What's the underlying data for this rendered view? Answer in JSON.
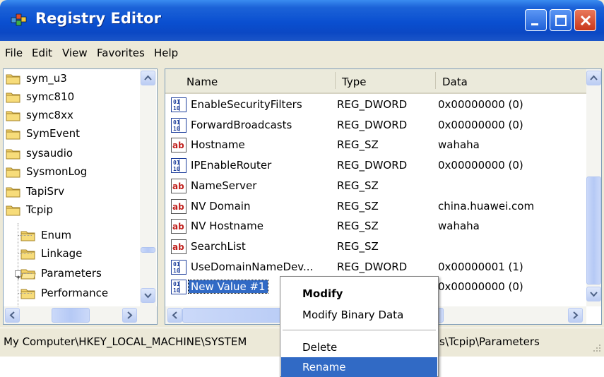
{
  "window": {
    "title": "Registry Editor"
  },
  "menu": [
    "File",
    "Edit",
    "View",
    "Favorites",
    "Help"
  ],
  "tree": {
    "items": [
      {
        "label": "sym_u3"
      },
      {
        "label": "symc810"
      },
      {
        "label": "symc8xx"
      },
      {
        "label": "SymEvent"
      },
      {
        "label": "sysaudio"
      },
      {
        "label": "SysmonLog"
      },
      {
        "label": "TapiSrv"
      },
      {
        "label": "Tcpip"
      },
      {
        "label": "Enum"
      },
      {
        "label": "Linkage"
      },
      {
        "label": "Parameters"
      },
      {
        "label": "Performance"
      }
    ]
  },
  "list": {
    "columns": [
      "Name",
      "Type",
      "Data"
    ],
    "rows": [
      {
        "icon": "binary-value-icon",
        "name": "EnableSecurityFilters",
        "type": "REG_DWORD",
        "data": "0x00000000 (0)"
      },
      {
        "icon": "binary-value-icon",
        "name": "ForwardBroadcasts",
        "type": "REG_DWORD",
        "data": "0x00000000 (0)"
      },
      {
        "icon": "string-value-icon",
        "name": "Hostname",
        "type": "REG_SZ",
        "data": "wahaha"
      },
      {
        "icon": "binary-value-icon",
        "name": "IPEnableRouter",
        "type": "REG_DWORD",
        "data": "0x00000000 (0)"
      },
      {
        "icon": "string-value-icon",
        "name": "NameServer",
        "type": "REG_SZ",
        "data": ""
      },
      {
        "icon": "string-value-icon",
        "name": "NV Domain",
        "type": "REG_SZ",
        "data": "china.huawei.com"
      },
      {
        "icon": "string-value-icon",
        "name": "NV Hostname",
        "type": "REG_SZ",
        "data": "wahaha"
      },
      {
        "icon": "string-value-icon",
        "name": "SearchList",
        "type": "REG_SZ",
        "data": ""
      },
      {
        "icon": "binary-value-icon",
        "name": "UseDomainNameDev...",
        "type": "REG_DWORD",
        "data": "0x00000001 (1)"
      },
      {
        "icon": "binary-value-icon",
        "name": "New Value #1",
        "type": "",
        "data": "0x00000000 (0)"
      }
    ]
  },
  "status": {
    "path_left": "My Computer\\HKEY_LOCAL_MACHINE\\SYSTEM",
    "path_right": "s\\Tcpip\\Parameters"
  },
  "context_menu": {
    "items": [
      "Modify",
      "Modify Binary Data",
      "Delete",
      "Rename"
    ]
  }
}
